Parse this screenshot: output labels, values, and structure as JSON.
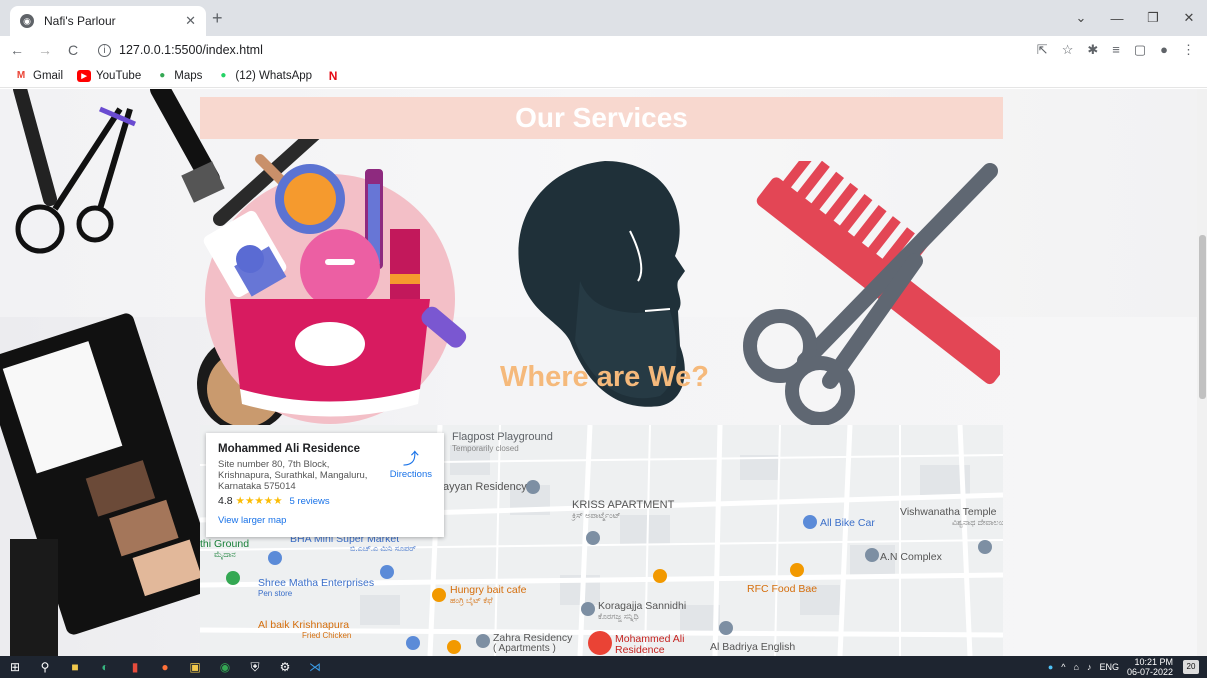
{
  "browser": {
    "tab_title": "Nafi's Parlour",
    "url": "127.0.0.1:5500/index.html",
    "bookmarks": [
      {
        "label": "Gmail",
        "icon": "gmail-icon"
      },
      {
        "label": "YouTube",
        "icon": "youtube-icon"
      },
      {
        "label": "Maps",
        "icon": "maps-icon"
      },
      {
        "label": "(12) WhatsApp",
        "icon": "whatsapp-icon"
      },
      {
        "label": "",
        "icon": "netflix-icon"
      }
    ]
  },
  "page": {
    "services_heading": "Our Services",
    "location_heading": "Where are We?"
  },
  "map_card": {
    "name": "Mohammed Ali Residence",
    "address": "Site number 80, 7th Block, Krishnapura, Surathkal, Mangaluru, Karnataka 575014",
    "rating": "4.8",
    "stars": "★★★★★",
    "reviews": "5 reviews",
    "directions": "Directions",
    "larger_map": "View larger map"
  },
  "map_labels": {
    "flagpost": "Flagpost Playground",
    "temp_closed": "Temporarily closed",
    "residency": "ayyan Residency",
    "kriss": "KRISS APARTMENT",
    "kriss_sub": "ಕ್ರಿಸ್ ಅಪಾರ್ಟ್ಮೆಂಟ್",
    "bike_car": "All Bike Car",
    "vishwanatha": "Vishwanatha Temple",
    "vishwanatha_sub": "ವಿಶ್ವನಾಥ ದೇವಾಲಯ",
    "ground": "thi Ground",
    "ground_sub": "ಮೈದಾನ",
    "bha": "BHA Mini Super Market",
    "bha_sub": "ಬಿ.ಎಚ್.ಎ ಮಿನಿ ಸೂಪರ್",
    "an_complex": "A.N Complex",
    "shree": "Shree Matha Enterprises",
    "pen_store": "Pen store",
    "hungry": "Hungry bait cafe",
    "hungry_sub": "ಹಂಗ್ರಿ ಬೈಟ್ ಕೆಫೆ",
    "koragajja": "Koragajja Sannidhi",
    "koragajja_sub": "ಕೊರಗಜ್ಜ ಸನ್ನಿಧಿ",
    "rfc": "RFC Food Bae",
    "albaik": "Al baik Krishnapura",
    "fried_chicken": "Fried Chicken",
    "zahra": "Zahra Residency",
    "zahra_sub": "( Apartments )",
    "mohammed_pin": "Mohammed Ali Residence",
    "badriya": "Al Badriya English"
  },
  "taskbar": {
    "lang": "ENG",
    "time": "10:21 PM",
    "date": "06-07-2022",
    "notif_count": "20"
  },
  "colors": {
    "banner_bg": "#f8d8cf",
    "heading_orange": "#f5b97b",
    "comb_red": "#e34655",
    "scissors_gray": "#5f6772",
    "cosmetic_pink": "#d81b60"
  }
}
